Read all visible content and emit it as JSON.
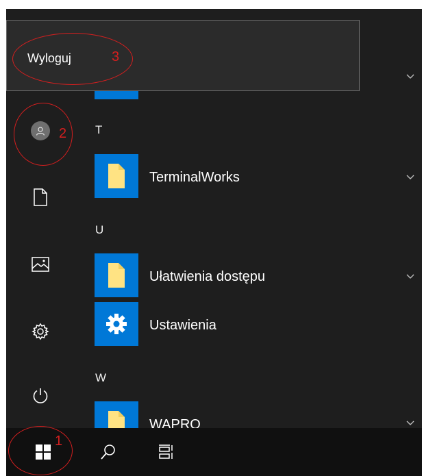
{
  "start_menu": {
    "power_menu": {
      "sign_out_label": "Wyloguj"
    },
    "rail": {
      "account": {
        "icon": "user-avatar-icon"
      },
      "documents": {
        "icon": "document-icon"
      },
      "pictures": {
        "icon": "pictures-icon"
      },
      "settings": {
        "icon": "gear-icon"
      },
      "power": {
        "icon": "power-icon"
      }
    },
    "app_list": {
      "groups": [
        {
          "letter": "T",
          "apps": [
            {
              "label": "TerminalWorks",
              "icon": "folder-icon",
              "expandable": true
            }
          ]
        },
        {
          "letter": "U",
          "apps": [
            {
              "label": "Ułatwienia dostępu",
              "icon": "folder-icon",
              "expandable": true
            },
            {
              "label": "Ustawienia",
              "icon": "settings-gear-icon",
              "expandable": false
            }
          ]
        },
        {
          "letter": "W",
          "apps": [
            {
              "label": "WAPRO",
              "icon": "folder-icon",
              "expandable": true
            }
          ]
        }
      ]
    }
  },
  "taskbar": {
    "start": {
      "icon": "windows-logo-icon"
    },
    "search": {
      "icon": "search-icon"
    },
    "task_view": {
      "icon": "task-view-icon"
    }
  },
  "annotations": {
    "marker_1": "1",
    "marker_2": "2",
    "marker_3": "3"
  },
  "colors": {
    "menu_bg": "#1e1e1e",
    "tile_blue": "#0078d7",
    "folder_yellow": "#ffe383",
    "annotation_red": "#d51f1f",
    "taskbar_bg": "#101010"
  }
}
